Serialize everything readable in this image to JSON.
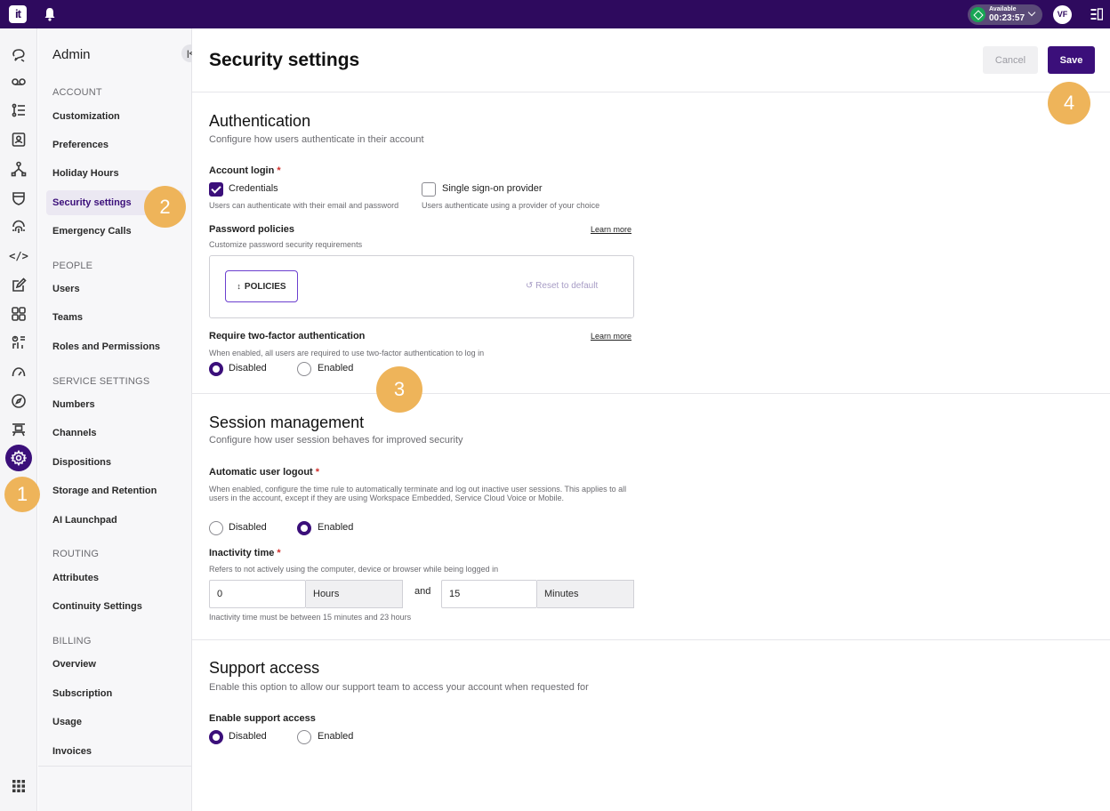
{
  "topbar": {
    "logo": "it",
    "status_label": "Available",
    "status_time": "00:23:57",
    "avatar_initials": "VF"
  },
  "rail": {
    "icons": [
      "chat-icon",
      "voicemail-icon",
      "task-list-icon",
      "contacts-icon",
      "workflow-icon",
      "shield-icon",
      "fingerprint-icon",
      "code-icon",
      "edit-icon",
      "apps-icon",
      "analytics-icon",
      "gauge-icon",
      "compass-icon",
      "conveyor-icon",
      "settings-icon",
      "grid-icon"
    ],
    "active": "settings-icon"
  },
  "nav": {
    "title": "Admin",
    "sections": [
      {
        "label": "ACCOUNT",
        "items": [
          "Customization",
          "Preferences",
          "Holiday Hours",
          "Security settings",
          "Emergency Calls"
        ]
      },
      {
        "label": "PEOPLE",
        "items": [
          "Users",
          "Teams",
          "Roles and Permissions"
        ]
      },
      {
        "label": "SERVICE SETTINGS",
        "items": [
          "Numbers",
          "Channels",
          "Dispositions",
          "Storage and Retention",
          "AI Launchpad"
        ]
      },
      {
        "label": "ROUTING",
        "items": [
          "Attributes",
          "Continuity Settings"
        ]
      },
      {
        "label": "BILLING",
        "items": [
          "Overview",
          "Subscription",
          "Usage",
          "Invoices"
        ]
      }
    ],
    "active_item": "Security settings"
  },
  "main": {
    "title": "Security settings",
    "cancel_label": "Cancel",
    "save_label": "Save",
    "authentication": {
      "heading": "Authentication",
      "description": "Configure how users authenticate in their account",
      "account_login_label": "Account login",
      "credentials_label": "Credentials",
      "credentials_checked": true,
      "credentials_help": "Users can authenticate with their email and password",
      "sso_label": "Single sign-on provider",
      "sso_checked": false,
      "sso_help": "Users authenticate using a provider of your choice",
      "password_policies_label": "Password policies",
      "password_policies_help": "Customize password security requirements",
      "learn_more": "Learn more",
      "policies_button": "POLICIES",
      "reset_label": "Reset to default",
      "two_factor_label": "Require two-factor authentication",
      "two_factor_help": "When enabled, all users are required to use two-factor authentication to log in",
      "two_factor_value": "Disabled"
    },
    "session": {
      "heading": "Session management",
      "description": "Configure how user session behaves for improved security",
      "auto_logout_label": "Automatic user logout",
      "auto_logout_help": "When enabled, configure the time rule to automatically terminate and log out inactive user sessions. This applies to all users in the account, except if they are using Workspace Embedded, Service Cloud Voice or Mobile.",
      "auto_logout_value": "Enabled",
      "inactivity_label": "Inactivity time",
      "inactivity_help": "Refers to not actively using the computer, device or browser while being logged in",
      "hours_value": "0",
      "hours_unit": "Hours",
      "and_label": "and",
      "minutes_value": "15",
      "minutes_unit": "Minutes",
      "inactivity_note": "Inactivity time must be between 15 minutes and 23 hours"
    },
    "support": {
      "heading": "Support access",
      "description": "Enable this option to allow our support team to access your account when requested for",
      "enable_label": "Enable support access",
      "value": "Disabled"
    },
    "radio_labels": {
      "disabled": "Disabled",
      "enabled": "Enabled"
    }
  },
  "markers": [
    "1",
    "2",
    "3",
    "4"
  ],
  "colors": {
    "brand": "#2e0a5e",
    "accent": "#3b0f7a",
    "marker": "#eeb45a",
    "status": "#17a654"
  }
}
